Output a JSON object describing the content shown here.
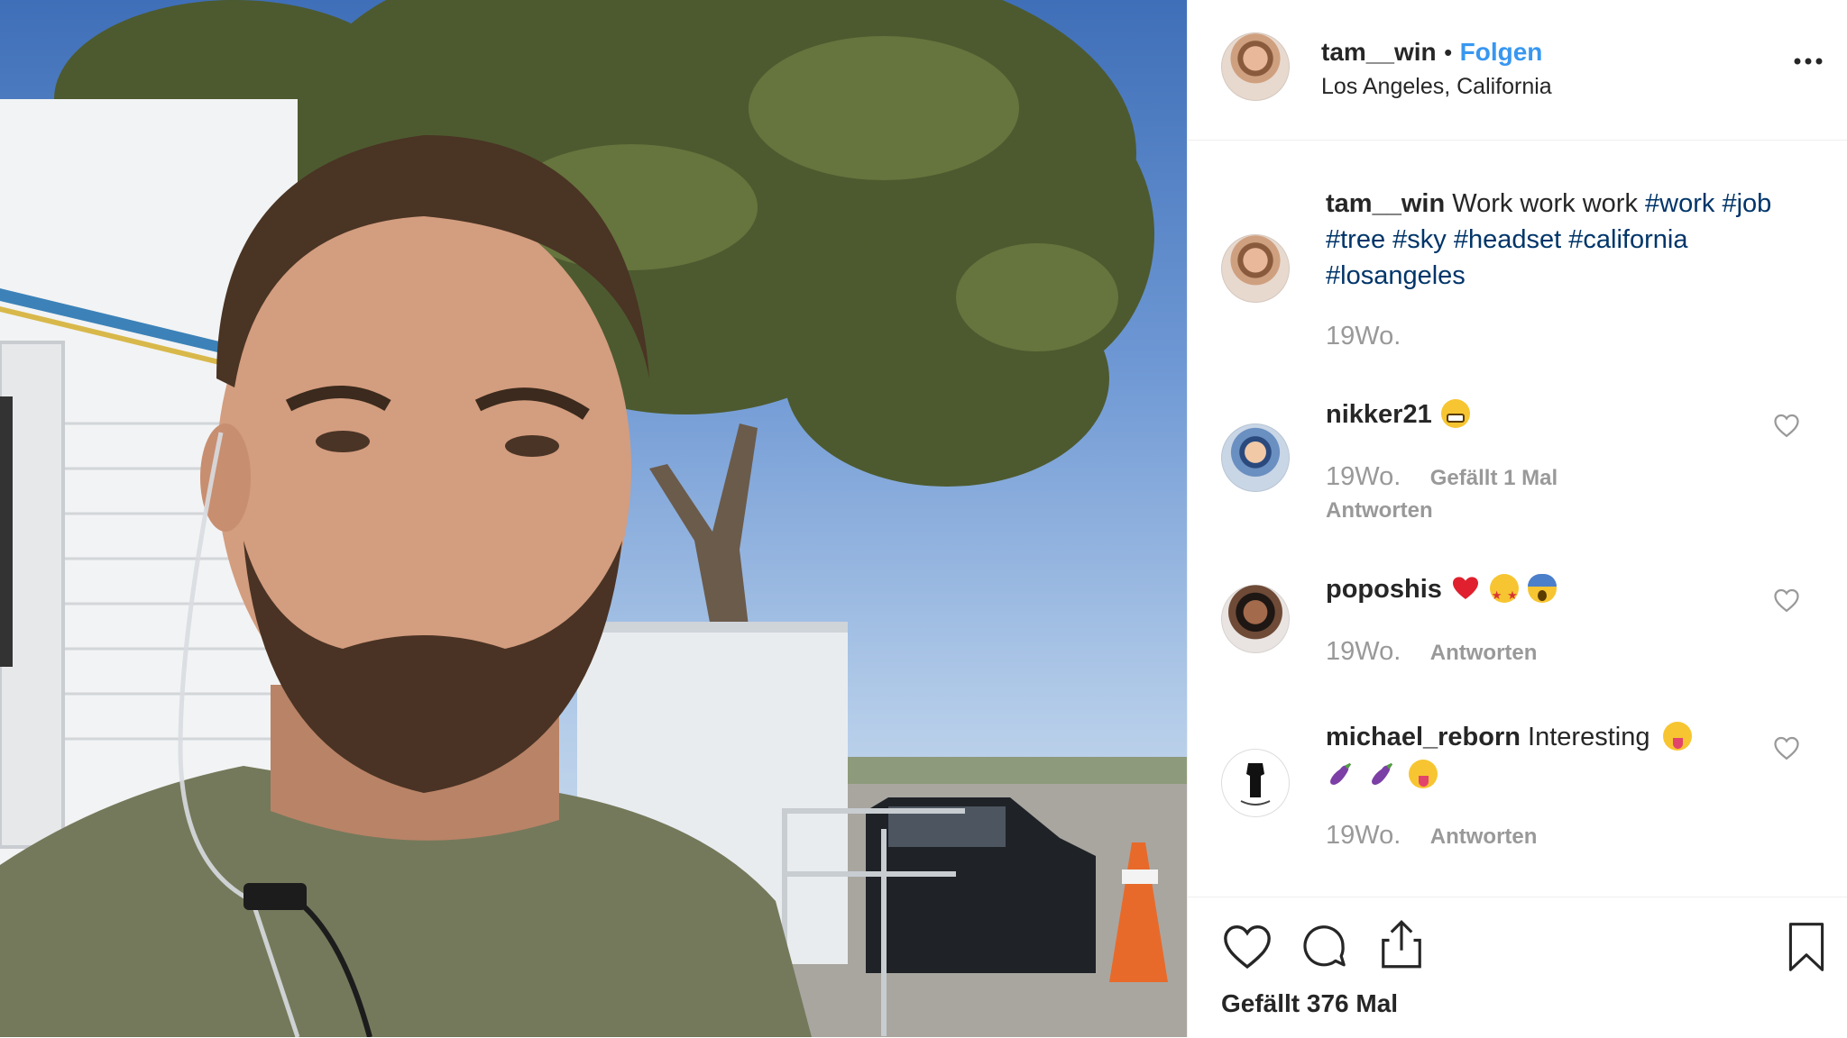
{
  "post": {
    "author": "tam__win",
    "separator": "•",
    "follow_label": "Folgen",
    "location": "Los Angeles, California",
    "more_icon": "more-horizontal-icon"
  },
  "caption": {
    "username": "tam__win",
    "text": "Work work work",
    "hashtags": [
      "#work",
      "#job",
      "#tree",
      "#sky",
      "#headset",
      "#california",
      "#losangeles"
    ],
    "time": "19Wo."
  },
  "comments": [
    {
      "username": "nikker21",
      "text": "",
      "emojis": [
        "grinning-face"
      ],
      "time": "19Wo.",
      "likes": "Gefällt 1 Mal",
      "reply": "Antworten"
    },
    {
      "username": "poposhis",
      "text": "",
      "emojis": [
        "red-heart",
        "star-struck",
        "screaming-face"
      ],
      "time": "19Wo.",
      "reply": "Antworten"
    },
    {
      "username": "michael_reborn",
      "text": "Interesting",
      "emojis": [
        "tongue-face",
        "eggplant",
        "eggplant",
        "tongue-face"
      ],
      "time": "19Wo.",
      "reply": "Antworten"
    }
  ],
  "actions": {
    "like_icon": "heart-icon",
    "comment_icon": "comment-icon",
    "share_icon": "share-icon",
    "save_icon": "bookmark-icon",
    "likes_count": "Gefällt 376 Mal"
  },
  "colors": {
    "link": "#3897f0",
    "hashtag": "#003569",
    "muted": "#999999",
    "text": "#262626"
  }
}
